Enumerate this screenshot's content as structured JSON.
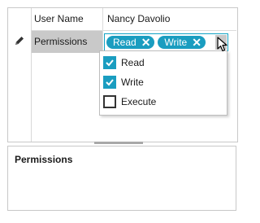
{
  "grid": {
    "header": {
      "label": "User Name",
      "value": "Nancy Davolio"
    },
    "permissions_row": {
      "label": "Permissions",
      "tags": [
        {
          "label": "Read",
          "remove_icon": "✕"
        },
        {
          "label": "Write",
          "remove_icon": "✕"
        }
      ]
    }
  },
  "dropdown": {
    "options": [
      {
        "label": "Read",
        "checked": true
      },
      {
        "label": "Write",
        "checked": true
      },
      {
        "label": "Execute",
        "checked": false
      }
    ]
  },
  "description_panel": {
    "title": "Permissions"
  },
  "colors": {
    "accent": "#1a9dc0",
    "selected_row": "#c9c9c9"
  },
  "icons": {
    "edit": "pencil-icon",
    "toggle": "chevron-up-icon",
    "cursor": "mouse-pointer-icon",
    "check": "checkmark-icon"
  }
}
